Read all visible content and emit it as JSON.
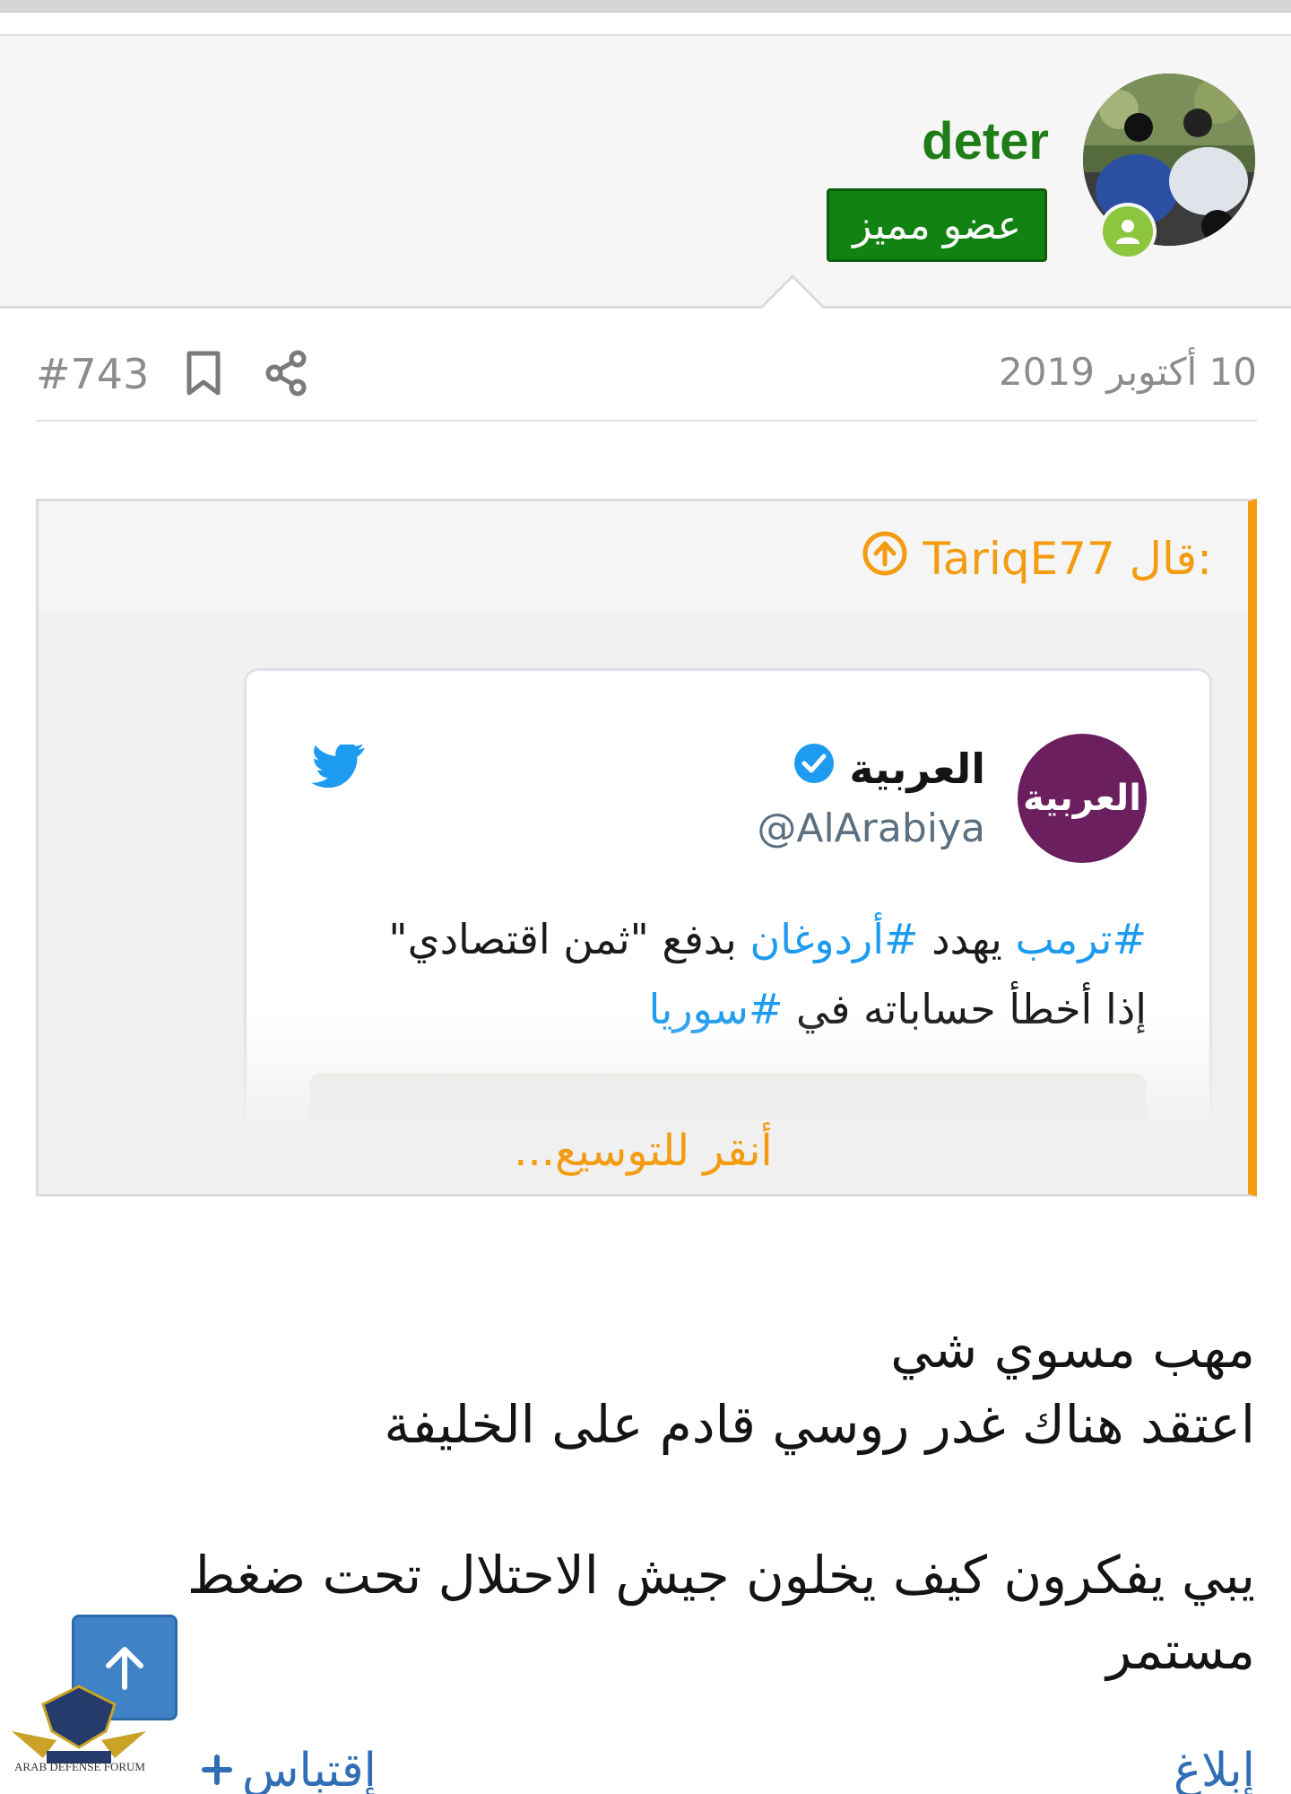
{
  "user": {
    "name": "deter",
    "title": "عضو مميز"
  },
  "post": {
    "date": "10 أكتوبر 2019",
    "number": "#743"
  },
  "quote": {
    "author": "TariqE77 قال:",
    "expand_label": "أنقر للتوسيع..."
  },
  "tweet": {
    "avatar_text": "العربية",
    "display_name": "العربية",
    "handle": "@AlArabiya",
    "text_parts": {
      "tag1": "#ترمب",
      "t1": " يهدد ",
      "tag2": "#أردوغان",
      "t2": " بدفع \"ثمن اقتصادي\" إذا أخطأ حساباته في ",
      "tag3": "#سوريا"
    }
  },
  "body": {
    "line1": "مهب مسوي شي",
    "line2": "اعتقد هناك غدر روسي قادم على الخليفة",
    "line3": "يبي يفكرون كيف يخلون جيش الاحتلال تحت ضغط مستمر"
  },
  "actions": {
    "quote_label": "إقتباس",
    "report_label": "إبلاغ"
  },
  "badge": {
    "text": "ARAB DEFENSE FORUM"
  },
  "colors": {
    "username": "#1e7d17",
    "user_title_bg": "#128212",
    "quote_accent": "#f39c12",
    "link": "#2f6db5",
    "hashtag": "#1d9bf0",
    "tweet_avatar": "#6b1f5e",
    "online": "#8cc63f"
  }
}
